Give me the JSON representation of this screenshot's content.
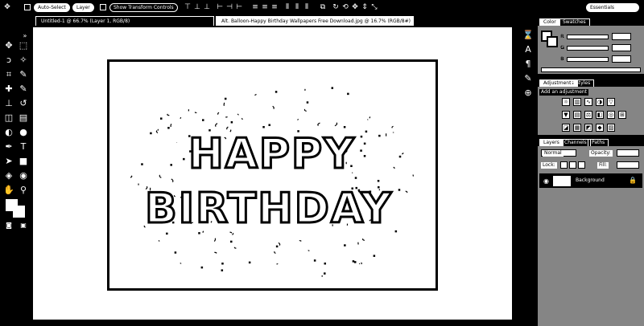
{
  "options_bar": {
    "auto_select_label": "Auto-Select",
    "layer_label": "Layer",
    "show_transform_label": "Show Transform Controls",
    "workspace_label": "Essentials"
  },
  "document": {
    "tabs": [
      {
        "label": "Untitled-1 @ 66.7% (Layer 1, RGB/8)"
      },
      {
        "label": "Alt. Balloon-Happy Birthday Wallpapers Free Download.jpg @ 16.7% (RGB/8#)"
      }
    ],
    "artwork": {
      "line1": "HAPPY",
      "line2": "BIRTHDAY"
    }
  },
  "panels": {
    "color_tabs": [
      "Color",
      "Swatches"
    ],
    "channels": [
      "R",
      "G",
      "B"
    ],
    "adjustments_tabs": [
      "Adjustments",
      "Styles"
    ],
    "adjustments_heading": "Add an adjustment",
    "layers_tabs": [
      "Layers",
      "Channels",
      "Paths"
    ],
    "blend_mode": "Normal",
    "opacity_label": "Opacity:",
    "lock_label": "Lock:",
    "fill_label": "Fill:",
    "layer_name": "Background"
  },
  "colors": {
    "foreground": "#ffffff",
    "background": "#ffffff"
  }
}
